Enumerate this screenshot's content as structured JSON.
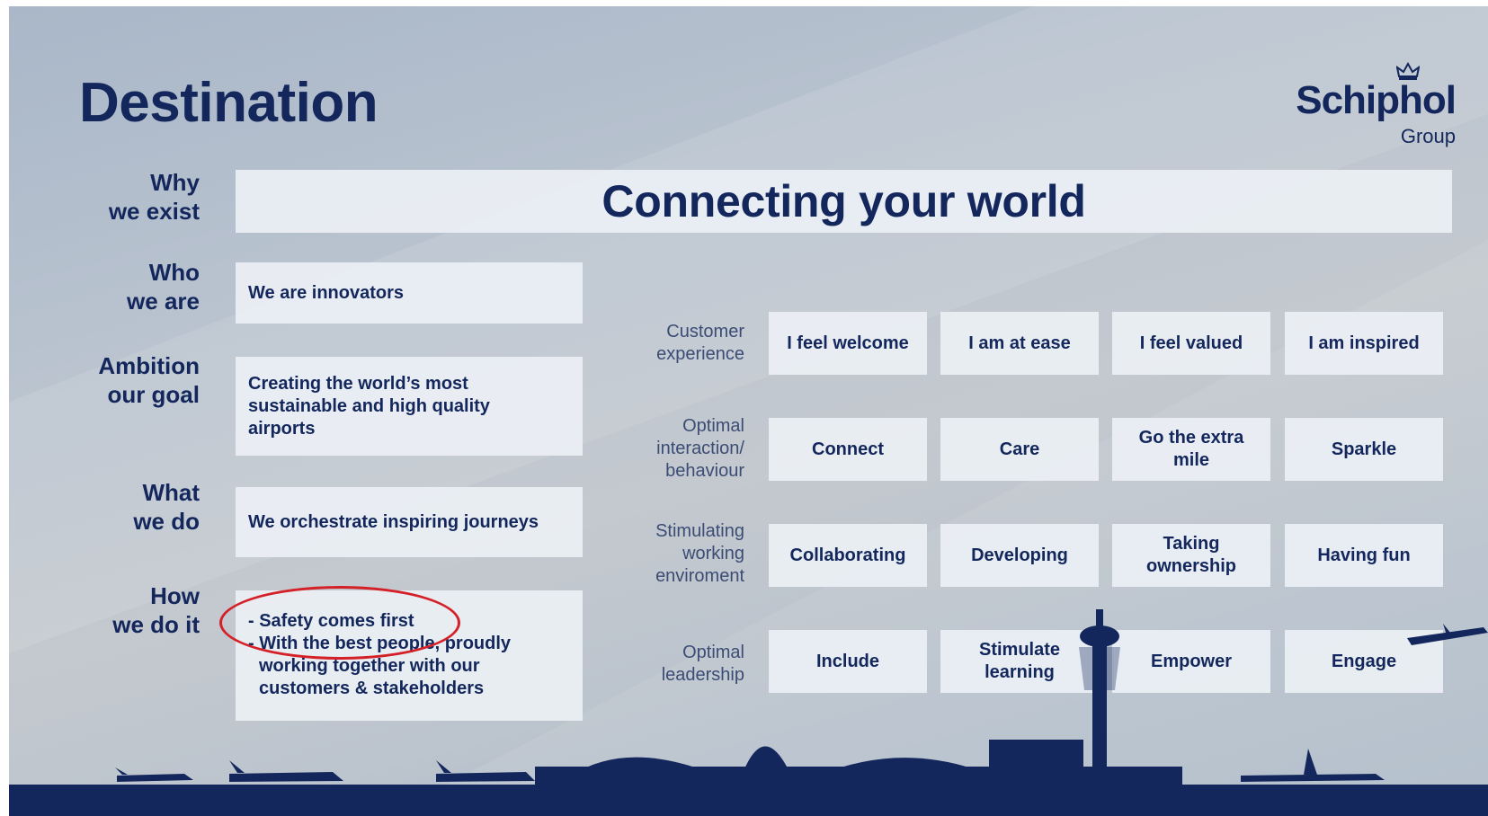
{
  "slide": {
    "title": "Destination",
    "logo": {
      "name": "Schiphol",
      "sub": "Group"
    },
    "banner": "Connecting your world",
    "rows": {
      "why": {
        "label": [
          "Why",
          "we exist"
        ]
      },
      "who": {
        "label": [
          "Who",
          "we are"
        ],
        "text": [
          "We are innovators"
        ]
      },
      "ambition": {
        "label": [
          "Ambition",
          "our goal"
        ],
        "text": [
          "Creating the world’s most",
          "sustainable and high quality",
          "airports"
        ]
      },
      "what": {
        "label": [
          "What",
          "we do"
        ],
        "text": [
          "We orchestrate inspiring journeys"
        ]
      },
      "how": {
        "label": [
          "How",
          "we do it"
        ],
        "text": [
          "- Safety comes first",
          "- With the best people, proudly",
          "working together with our",
          "customers & stakeholders"
        ]
      }
    },
    "grid": [
      {
        "label": [
          "Customer",
          "experience"
        ],
        "cells": [
          [
            "I feel welcome"
          ],
          [
            "I am at ease"
          ],
          [
            "I feel valued"
          ],
          [
            "I am inspired"
          ]
        ]
      },
      {
        "label": [
          "Optimal",
          "interaction/",
          "behaviour"
        ],
        "cells": [
          [
            "Connect"
          ],
          [
            "Care"
          ],
          [
            "Go the extra",
            "mile"
          ],
          [
            "Sparkle"
          ]
        ]
      },
      {
        "label": [
          "Stimulating",
          "working",
          "enviroment"
        ],
        "cells": [
          [
            "Collaborating"
          ],
          [
            "Developing"
          ],
          [
            "Taking",
            "ownership"
          ],
          [
            "Having fun"
          ]
        ]
      },
      {
        "label": [
          "Optimal",
          "leadership"
        ],
        "cells": [
          [
            "Include"
          ],
          [
            "Stimulate",
            "learning"
          ],
          [
            "Empower"
          ],
          [
            "Engage"
          ]
        ]
      }
    ],
    "colors": {
      "navy": "#13275c",
      "highlight_circle": "#d42027"
    }
  }
}
